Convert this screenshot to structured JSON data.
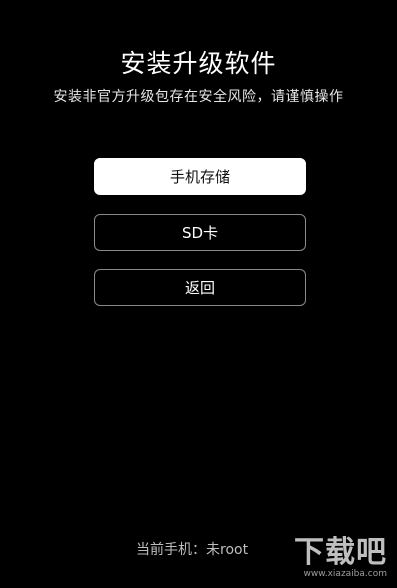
{
  "dialog": {
    "title": "安装升级软件",
    "subtitle": "安装非官方升级包存在安全风险，请谨慎操作"
  },
  "buttons": {
    "phone_storage": "手机存储",
    "sd_card": "SD卡",
    "back": "返回"
  },
  "status": {
    "text": "当前手机：未root"
  },
  "watermark": {
    "text": "下载吧",
    "url": "www.xiazaiba.com"
  },
  "colors": {
    "background": "#000000",
    "primary_button_bg": "#ffffff",
    "outline_border": "#8a8a8a"
  }
}
